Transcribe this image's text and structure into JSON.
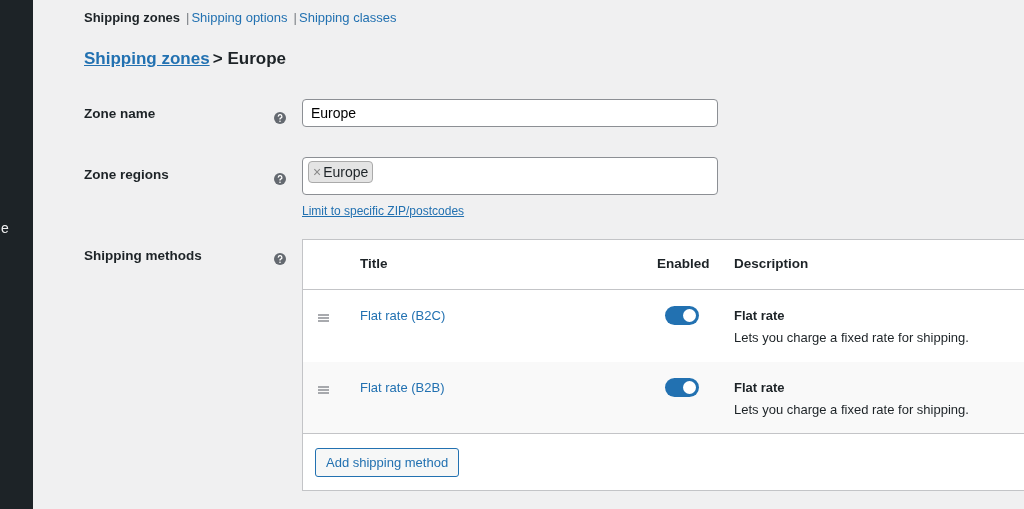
{
  "sidebar": {
    "items": [
      {
        "label": "e"
      }
    ]
  },
  "subnav_separator": "|",
  "subnav": [
    {
      "label": "Shipping zones",
      "selected": true
    },
    {
      "label": "Shipping options",
      "selected": false
    },
    {
      "label": "Shipping classes",
      "selected": false
    }
  ],
  "breadcrumb": {
    "link": "Shipping zones",
    "current": "> Europe"
  },
  "zone_name": {
    "label": "Zone name",
    "value": "Europe"
  },
  "zone_regions": {
    "label": "Zone regions",
    "tags": [
      "Europe"
    ],
    "remove": "×",
    "link": "Limit to specific ZIP/postcodes"
  },
  "shipping_methods": {
    "label": "Shipping methods",
    "columns": [
      "Title",
      "Enabled",
      "Description"
    ],
    "rows": [
      {
        "title": "Flat rate (B2C)",
        "enabled": true,
        "desc_title": "Flat rate",
        "description": "Lets you charge a fixed rate for shipping."
      },
      {
        "title": "Flat rate (B2B)",
        "enabled": true,
        "desc_title": "Flat rate",
        "description": "Lets you charge a fixed rate for shipping."
      }
    ],
    "add_button": "Add shipping method"
  }
}
